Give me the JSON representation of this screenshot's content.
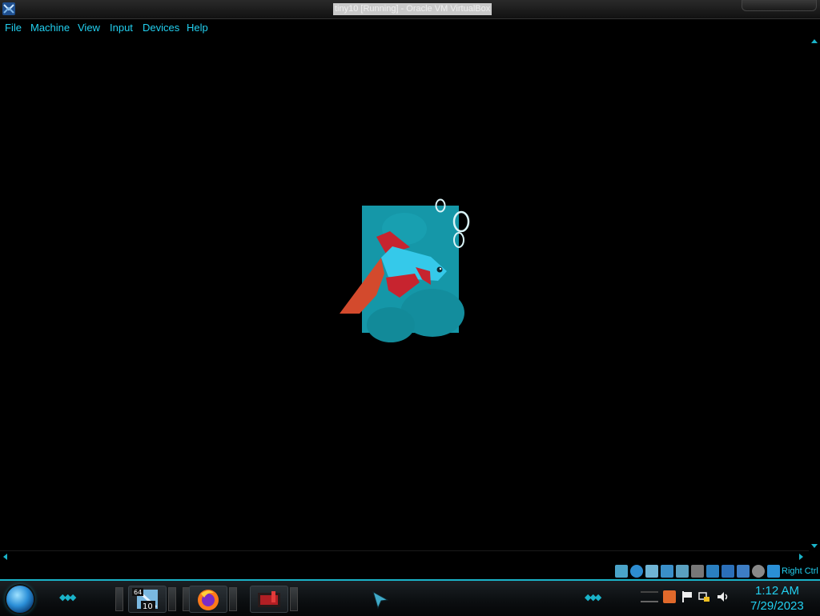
{
  "window": {
    "title": "tiny10 [Running] - Oracle VM VirtualBox",
    "app_icon": "virtualbox-icon"
  },
  "menu": {
    "items": [
      {
        "label": "File"
      },
      {
        "label": "Machine"
      },
      {
        "label": "View"
      },
      {
        "label": "Input"
      },
      {
        "label": "Devices"
      },
      {
        "label": "Help"
      }
    ]
  },
  "guest": {
    "content": "betta-fish-boot-logo"
  },
  "statusbar": {
    "icons": [
      "hard-disk-icon",
      "optical-disk-icon",
      "audio-icon",
      "network-icon",
      "usb-icon",
      "shared-folder-icon",
      "display-icon",
      "recording-icon",
      "virtualization-icon",
      "cpu-icon",
      "mouse-integration-icon"
    ],
    "host_key": "Right Ctrl"
  },
  "taskbar": {
    "start_icon": "start-orb-icon",
    "buttons": [
      {
        "name": "tiny10-64-icon",
        "badge_top": "64",
        "badge_bottom": "10"
      },
      {
        "name": "firefox-icon"
      },
      {
        "name": "app-icon"
      }
    ],
    "tray_icons": [
      "keyboard-icon",
      "java-icon",
      "flag-icon",
      "network-icon",
      "volume-icon"
    ],
    "clock": {
      "time": "1:12 AM",
      "date": "7/29/2023"
    }
  },
  "colors": {
    "accent": "#22d0f0",
    "tank": "#1597a8",
    "fish_body": "#35c9ea",
    "fish_fin": "#c7242f",
    "fish_tail": "#d34a2d"
  }
}
